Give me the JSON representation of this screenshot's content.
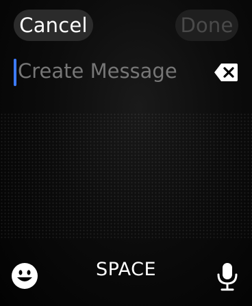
{
  "header": {
    "cancel_label": "Cancel",
    "done_label": "Done"
  },
  "input": {
    "placeholder": "Create Message",
    "value": ""
  },
  "keyboard": {
    "space_label": "SPACE",
    "icons": [
      "emoji-icon",
      "delete-icon",
      "microphone-icon"
    ]
  },
  "colors": {
    "caret": "#3d7bff",
    "background": "#000000"
  }
}
